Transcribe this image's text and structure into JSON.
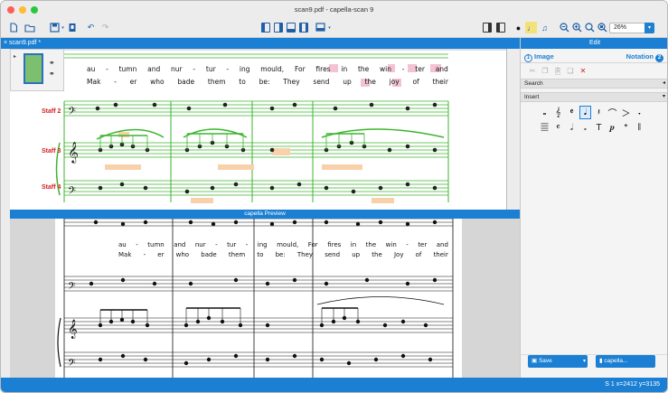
{
  "window": {
    "title": "scan9.pdf - capella-scan 9"
  },
  "toolbar": {
    "zoom": "26%"
  },
  "tabs": [
    {
      "label": "scan9.pdf *",
      "close": "×"
    }
  ],
  "scan": {
    "lyrics1": [
      "au",
      "-",
      "tumn",
      "and",
      "nur",
      "-",
      "tur",
      "-",
      "ing",
      "mould,",
      "For",
      "fires",
      "in",
      "the",
      "win",
      "-",
      "ter",
      "and"
    ],
    "lyrics2": [
      "Mak",
      "-",
      "er",
      "who",
      "bade",
      "them",
      "to",
      "be:",
      "They",
      "send",
      "up",
      "the",
      "joy",
      "of",
      "their"
    ],
    "staff_labels": [
      "Staff 2",
      "Staff 3",
      "Staff 4"
    ]
  },
  "preview": {
    "label": "capella Preview",
    "lyrics1": [
      "au",
      "-",
      "tumn",
      "and",
      "nur",
      "-",
      "tur",
      "-",
      "ing",
      "mould,",
      "For",
      "fires",
      "in",
      "the",
      "win",
      "-",
      "ter",
      "and"
    ],
    "lyrics2": [
      "Mak",
      "-",
      "er",
      "who",
      "bade",
      "them",
      "to",
      "be:",
      "They",
      "send",
      "up",
      "the",
      "Joy",
      "of",
      "their"
    ]
  },
  "right_panel": {
    "header": "Edit",
    "tab_image_num": "1",
    "tab_image": "Image",
    "tab_notation": "Notation",
    "tab_notation_num": "2",
    "section_search": "Search",
    "section_insert": "Insert",
    "palette_row1": [
      "𝅝",
      "𝄞",
      "𝄵",
      "𝅘𝅥",
      "𝄽",
      "⌒",
      "＞",
      "𝅏"
    ],
    "palette_row2": [
      "𝄚",
      "𝄴",
      "𝅗𝅥",
      "𝅗",
      "T",
      "𝆏",
      "𝄌",
      "𝄃"
    ],
    "button_save": "Save",
    "button_capella": "capella..."
  },
  "status": {
    "text": "S 1  x=2412 y=3135"
  }
}
